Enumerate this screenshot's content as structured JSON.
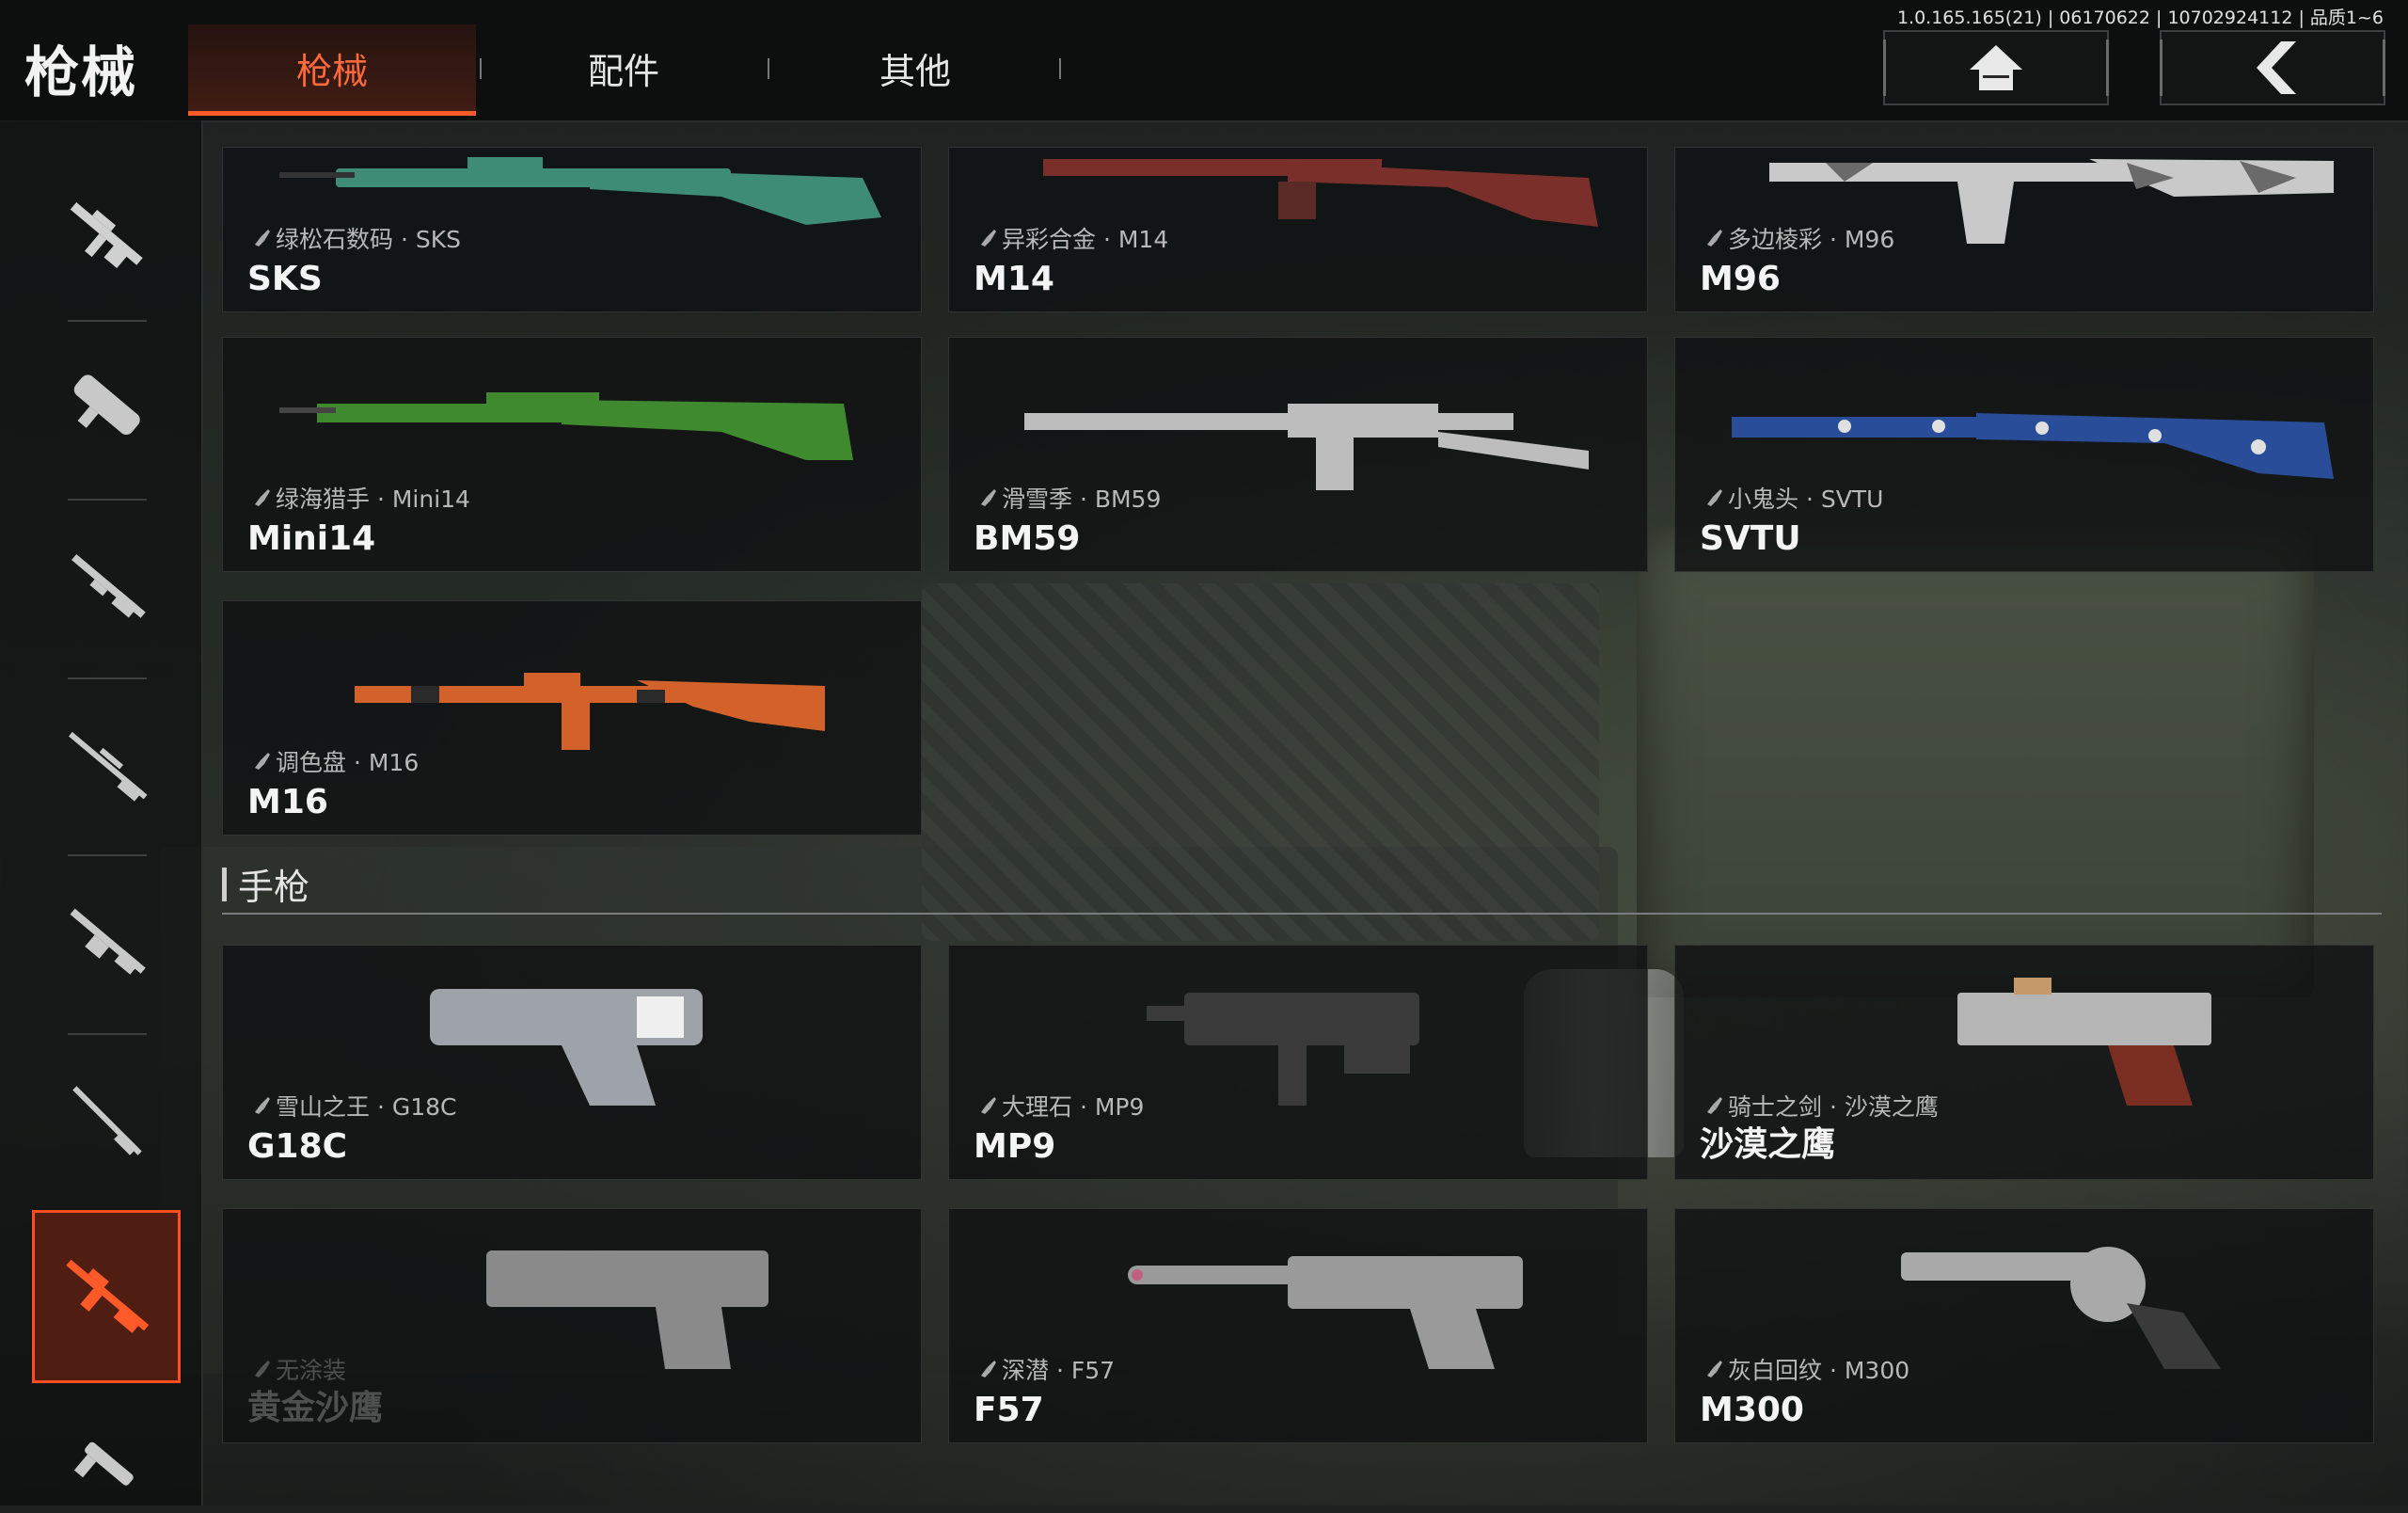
{
  "header": {
    "title": "枪械",
    "tabs": [
      {
        "label": "枪械",
        "active": true
      },
      {
        "label": "配件",
        "active": false
      },
      {
        "label": "其他",
        "active": false
      }
    ],
    "version": "1.0.165.165(21) | 06170622 | 10702924112 | 品质1~6",
    "home_icon": "home-icon",
    "back_icon": "back-arrow-icon"
  },
  "sidebar": {
    "items": [
      {
        "icon": "assault-rifle-icon",
        "active": false
      },
      {
        "icon": "smg-icon",
        "active": false
      },
      {
        "icon": "shotgun-icon",
        "active": false
      },
      {
        "icon": "sniper-rifle-icon",
        "active": false
      },
      {
        "icon": "lmg-icon",
        "active": false
      },
      {
        "icon": "dmr-icon",
        "active": false
      },
      {
        "icon": "marksman-rifle-icon",
        "active": true
      },
      {
        "icon": "pistol-icon",
        "active": false
      }
    ],
    "active_color": "#ff4d1f"
  },
  "rifles": [
    {
      "skin": "绿松石数码 · SKS",
      "name": "SKS",
      "color": "#3f8c74"
    },
    {
      "skin": "异彩合金 · M14",
      "name": "M14",
      "color": "#7a2f2a"
    },
    {
      "skin": "多边棱彩 · M96",
      "name": "M96",
      "color": "#c9c9c9"
    },
    {
      "skin": "绿海猎手 · Mini14",
      "name": "Mini14",
      "color": "#3f8a2f"
    },
    {
      "skin": "滑雪季 · BM59",
      "name": "BM59",
      "color": "#bdbdbd"
    },
    {
      "skin": "小鬼头 · SVTU",
      "name": "SVTU",
      "color": "#2a4d9a"
    },
    {
      "skin": "调色盘 · M16",
      "name": "M16",
      "color": "#d2622a"
    }
  ],
  "section": {
    "title": "手枪"
  },
  "pistols": [
    {
      "skin": "雪山之王 · G18C",
      "name": "G18C",
      "color": "#9da3a8",
      "locked": false
    },
    {
      "skin": "大理石 · MP9",
      "name": "MP9",
      "color": "#3b3b3b",
      "locked": false
    },
    {
      "skin": "骑士之剑 · 沙漠之鹰",
      "name": "沙漠之鹰",
      "color": "#b5b5b5",
      "locked": false
    },
    {
      "skin": "无涂装",
      "name": "黄金沙鹰",
      "color": "#8a8a8a",
      "locked": true
    },
    {
      "skin": "深潜 · F57",
      "name": "F57",
      "color": "#9a9a9a",
      "locked": false
    },
    {
      "skin": "灰白回纹 · M300",
      "name": "M300",
      "color": "#a9a9a9",
      "locked": false
    }
  ]
}
